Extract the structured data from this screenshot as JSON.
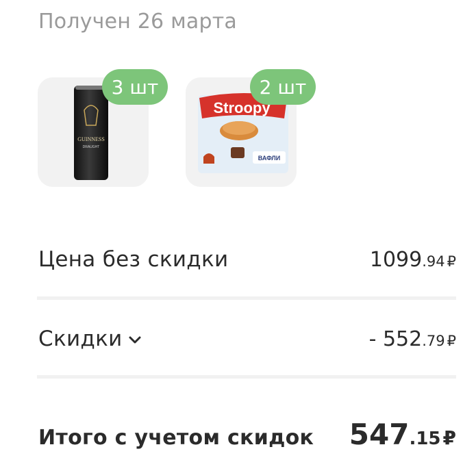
{
  "header": {
    "title": "Получен 26 марта"
  },
  "products": [
    {
      "name": "guinness-can",
      "qty": "3 шт",
      "brand_text": "GUINNESS",
      "sub_text": "DRAUGHT"
    },
    {
      "name": "stroopy-wafles",
      "qty": "2 шт",
      "brand_text": "Stroopy",
      "sub_text": "ВАФЛИ"
    }
  ],
  "summary": {
    "full_price_label": "Цена без скидки",
    "full_price_int": "1099",
    "full_price_dec": ".94",
    "discounts_label": "Скидки",
    "discounts_int": "- 552",
    "discounts_dec": ".79",
    "total_label": "Итого с учетом скидок",
    "total_int": "547",
    "total_dec": ".15",
    "currency": "₽"
  },
  "colors": {
    "badge": "#7dc57a",
    "tile": "#f2f2f2",
    "title": "#9a9a9a"
  }
}
